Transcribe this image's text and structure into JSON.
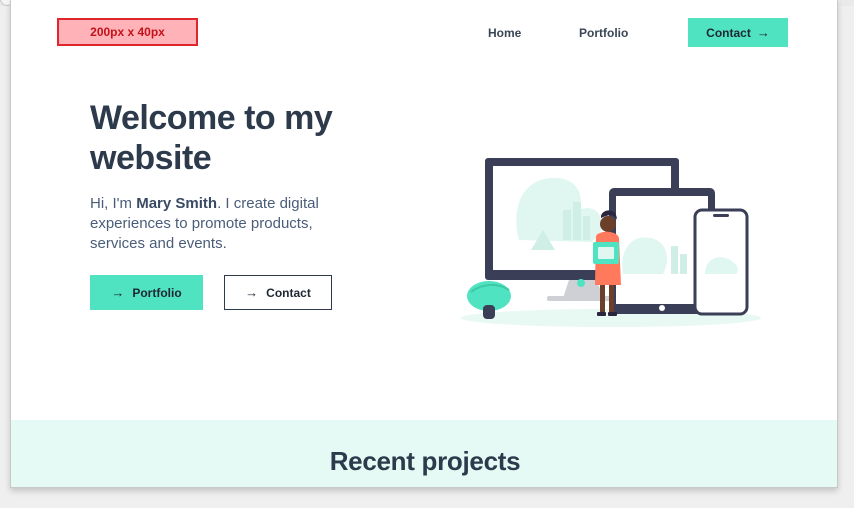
{
  "logo_placeholder": "200px x 40px",
  "nav": {
    "home_label": "Home",
    "portfolio_label": "Portfolio",
    "contact_label": "Contact"
  },
  "hero": {
    "title": "Welcome to my website",
    "intro_prefix": "Hi, I'm ",
    "name": "Mary Smith",
    "intro_suffix": ". I create digital experiences to promote products, services and events.",
    "portfolio_button": "Portfolio",
    "contact_button": "Contact"
  },
  "projects": {
    "title": "Recent projects"
  },
  "icons": {
    "arrow": "arrow-right-icon"
  },
  "colors": {
    "accent": "#4fe3c1",
    "heading": "#2c3a4c",
    "body_text": "#4a5d78",
    "placeholder_bg": "#ffb3b8",
    "placeholder_border": "#e0262c",
    "section_bg": "#e6faf5"
  }
}
